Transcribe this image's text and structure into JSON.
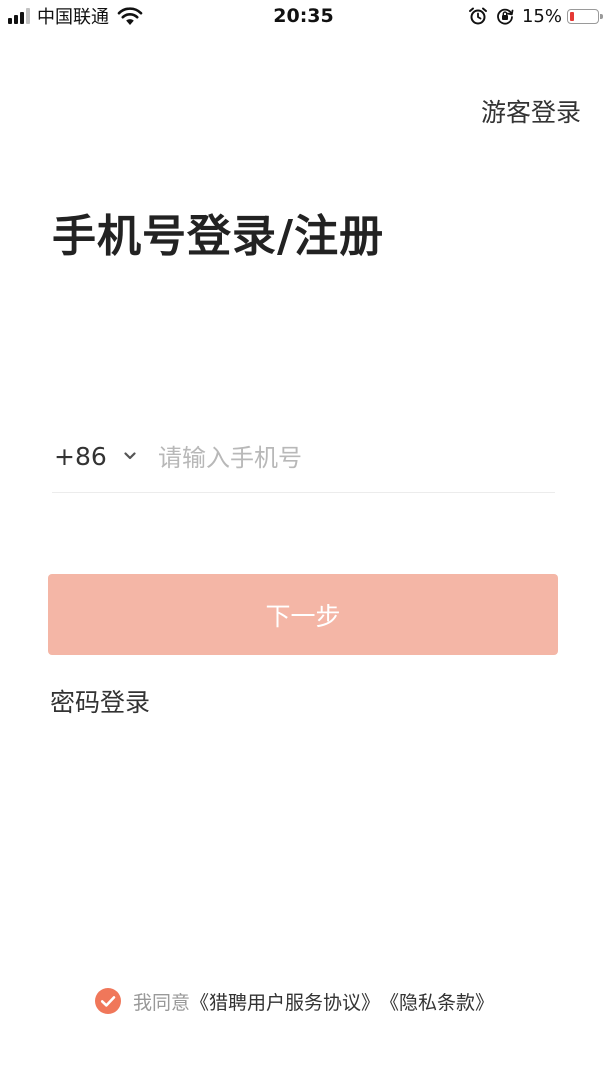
{
  "status_bar": {
    "carrier": "中国联通",
    "time": "20:35",
    "battery_percent": "15%",
    "battery_level": 0.15,
    "icons": [
      "signal-icon",
      "wifi-icon",
      "alarm-icon",
      "rotation-lock-icon",
      "battery-icon"
    ]
  },
  "header": {
    "guest_login": "游客登录"
  },
  "title": "手机号登录/注册",
  "phone": {
    "country_code": "+86",
    "placeholder": "请输入手机号",
    "value": ""
  },
  "next_button": {
    "label": "下一步",
    "enabled": false
  },
  "password_login": "密码登录",
  "agreement": {
    "checked": true,
    "prefix": "我同意",
    "service_link": "《猎聘用户服务协议》",
    "privacy_link": "《隐私条款》"
  },
  "colors": {
    "accent": "#f0775a",
    "button_disabled": "#f4b6a6",
    "text": "#333333",
    "placeholder": "#b8b8b8"
  }
}
